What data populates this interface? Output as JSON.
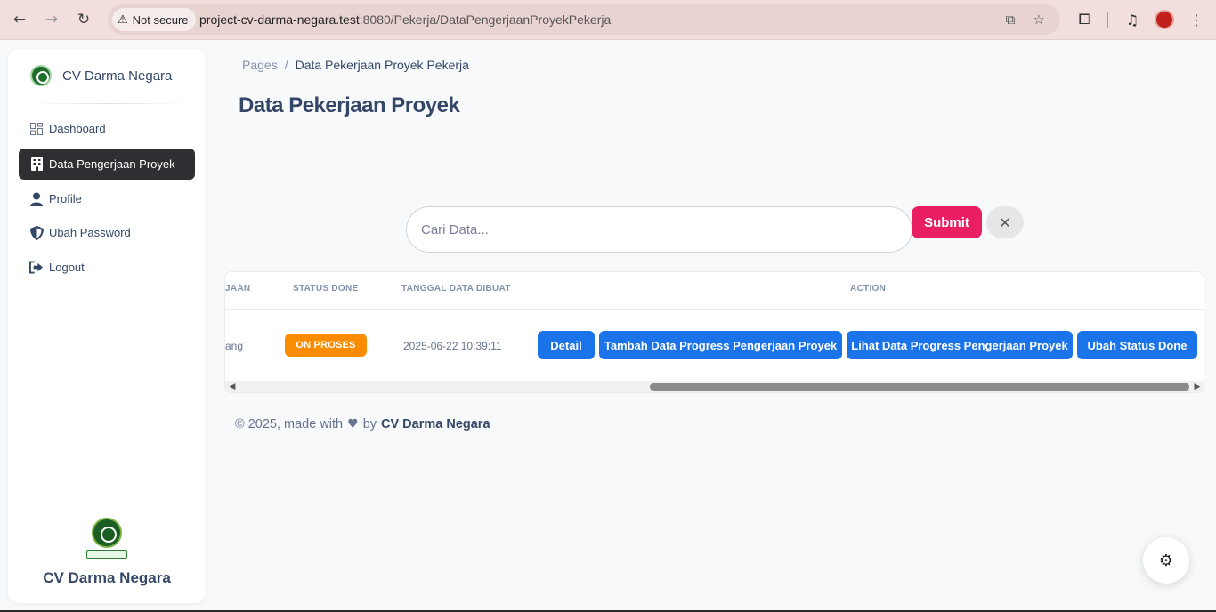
{
  "browser": {
    "security_label": "Not secure",
    "url_host": "project-cv-darma-negara.test",
    "url_rest": ":8080/Pekerja/DataPengerjaanProyekPekerja",
    "icons": [
      "back-icon",
      "forward-icon",
      "reload-icon",
      "warning-icon",
      "translate-icon",
      "star-icon",
      "extensions-icon",
      "media-icon",
      "profile-avatar",
      "menu-icon"
    ]
  },
  "sidebar": {
    "brand": "CV Darma Negara",
    "items": [
      {
        "label": "Dashboard",
        "icon": "dashboard-icon",
        "active": false
      },
      {
        "label": "Data Pengerjaan Proyek",
        "icon": "building-icon",
        "active": true
      },
      {
        "label": "Profile",
        "icon": "user-icon",
        "active": false
      },
      {
        "label": "Ubah Password",
        "icon": "shield-icon",
        "active": false
      },
      {
        "label": "Logout",
        "icon": "logout-icon",
        "active": false
      }
    ],
    "footer_name": "CV Darma Negara"
  },
  "breadcrumb": {
    "root": "Pages",
    "separator": "/",
    "current": "Data Pekerjaan Proyek Pekerja"
  },
  "page_title": "Data Pekerjaan Proyek",
  "search": {
    "placeholder": "Cari Data...",
    "submit_label": "Submit",
    "clear_label": "✕"
  },
  "table": {
    "headers": [
      "JAAN",
      "STATUS DONE",
      "TANGGAL DATA DIBUAT",
      "ACTION"
    ],
    "rows": [
      {
        "name_fragment": "ang",
        "status": "ON PROSES",
        "created": "2025-06-22 10:39:11",
        "actions": [
          "Detail",
          "Tambah Data Progress Pengerjaan Proyek",
          "Lihat Data Progress Pengerjaan Proyek",
          "Ubah Status Done"
        ]
      }
    ]
  },
  "footer": {
    "prefix": "© 2025, made with",
    "middle": "by",
    "brand": "CV Darma Negara"
  },
  "colors": {
    "primary_blue": "#1a73e8",
    "submit_pink": "#e91e63",
    "status_orange": "#fb8c00",
    "sidebar_active": "#2e2e33"
  }
}
